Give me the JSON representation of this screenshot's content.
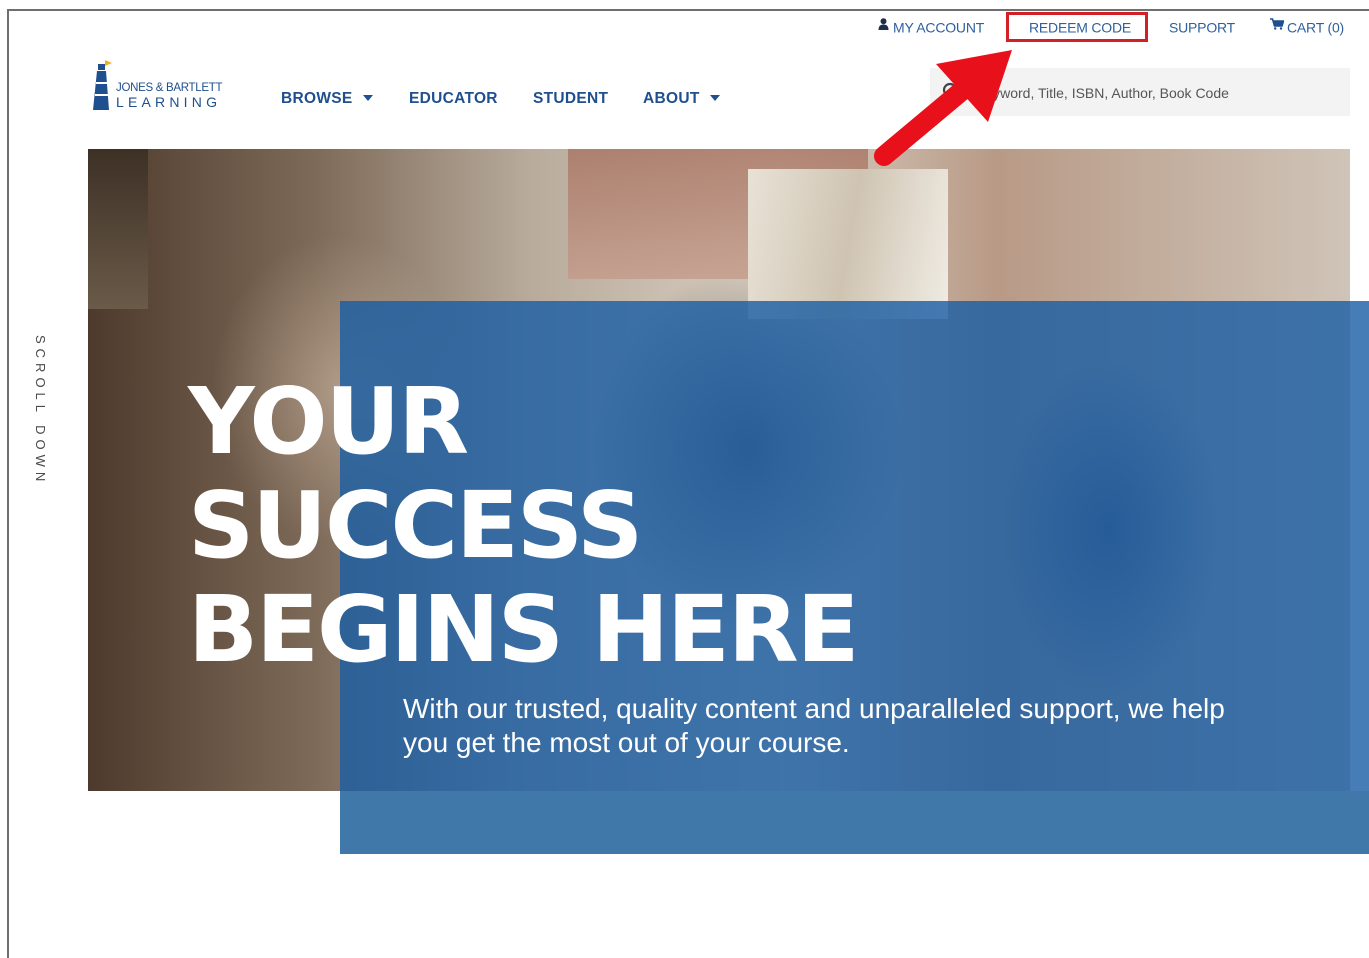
{
  "utility_bar": {
    "my_account": "MY ACCOUNT",
    "redeem_code": "REDEEM CODE",
    "support": "SUPPORT",
    "cart": "CART (0)"
  },
  "logo": {
    "line1": "JONES & BARTLETT",
    "line2": "LEARNING"
  },
  "nav": {
    "browse": "BROWSE",
    "educator": "EDUCATOR",
    "student": "STUDENT",
    "about": "ABOUT"
  },
  "search": {
    "placeholder": "Keyword, Title, ISBN, Author, Book Code"
  },
  "hero": {
    "headline_lines": [
      "YOUR",
      "SUCCESS",
      "BEGINS HERE"
    ],
    "subtext": "With our trusted, quality content and unparalleled support, we help you get the most out of your course."
  },
  "scroll_hint": "SCROLL DOWN",
  "colors": {
    "brand_blue": "#1f4f8e",
    "link_blue": "#2e5f9e",
    "overlay_blue": "#185ca4",
    "highlight_red": "#d31f26"
  }
}
